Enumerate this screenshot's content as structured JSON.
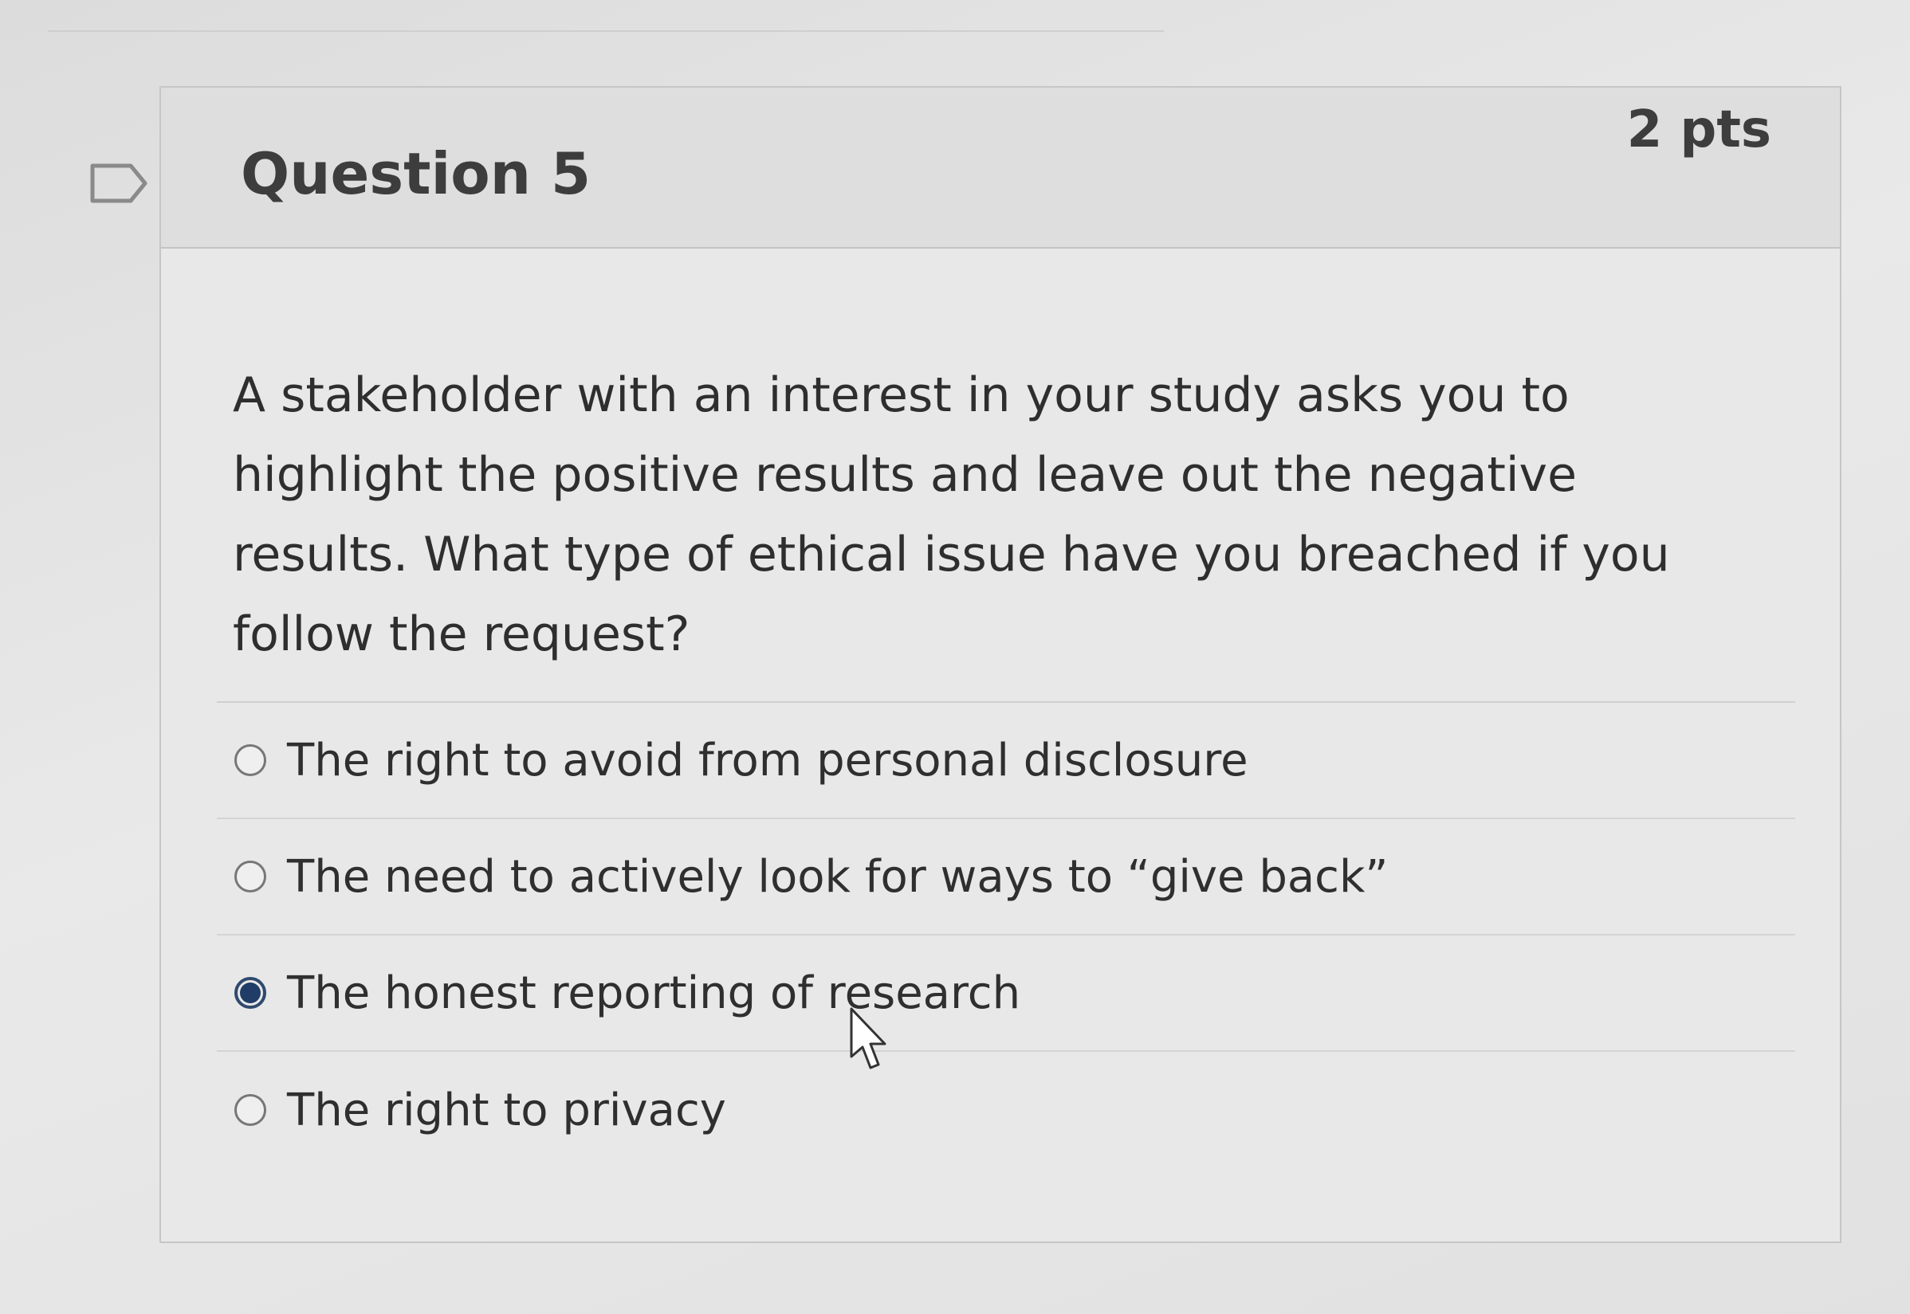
{
  "question": {
    "title": "Question 5",
    "points": "2 pts",
    "text": "A stakeholder with an interest in your study asks you to highlight the positive results and leave out the negative results. What type of ethical issue have you breached if you follow the request?",
    "flag_icon": "flag-outline-icon"
  },
  "answers": [
    {
      "label": "The right to avoid from personal disclosure",
      "selected": false
    },
    {
      "label": "The need to actively look for ways to “give back”",
      "selected": false
    },
    {
      "label": "The honest reporting of research",
      "selected": true
    },
    {
      "label": "The right to privacy",
      "selected": false
    }
  ],
  "colors": {
    "selected_radio": "#1f3d66",
    "text": "#2e2e2e"
  }
}
